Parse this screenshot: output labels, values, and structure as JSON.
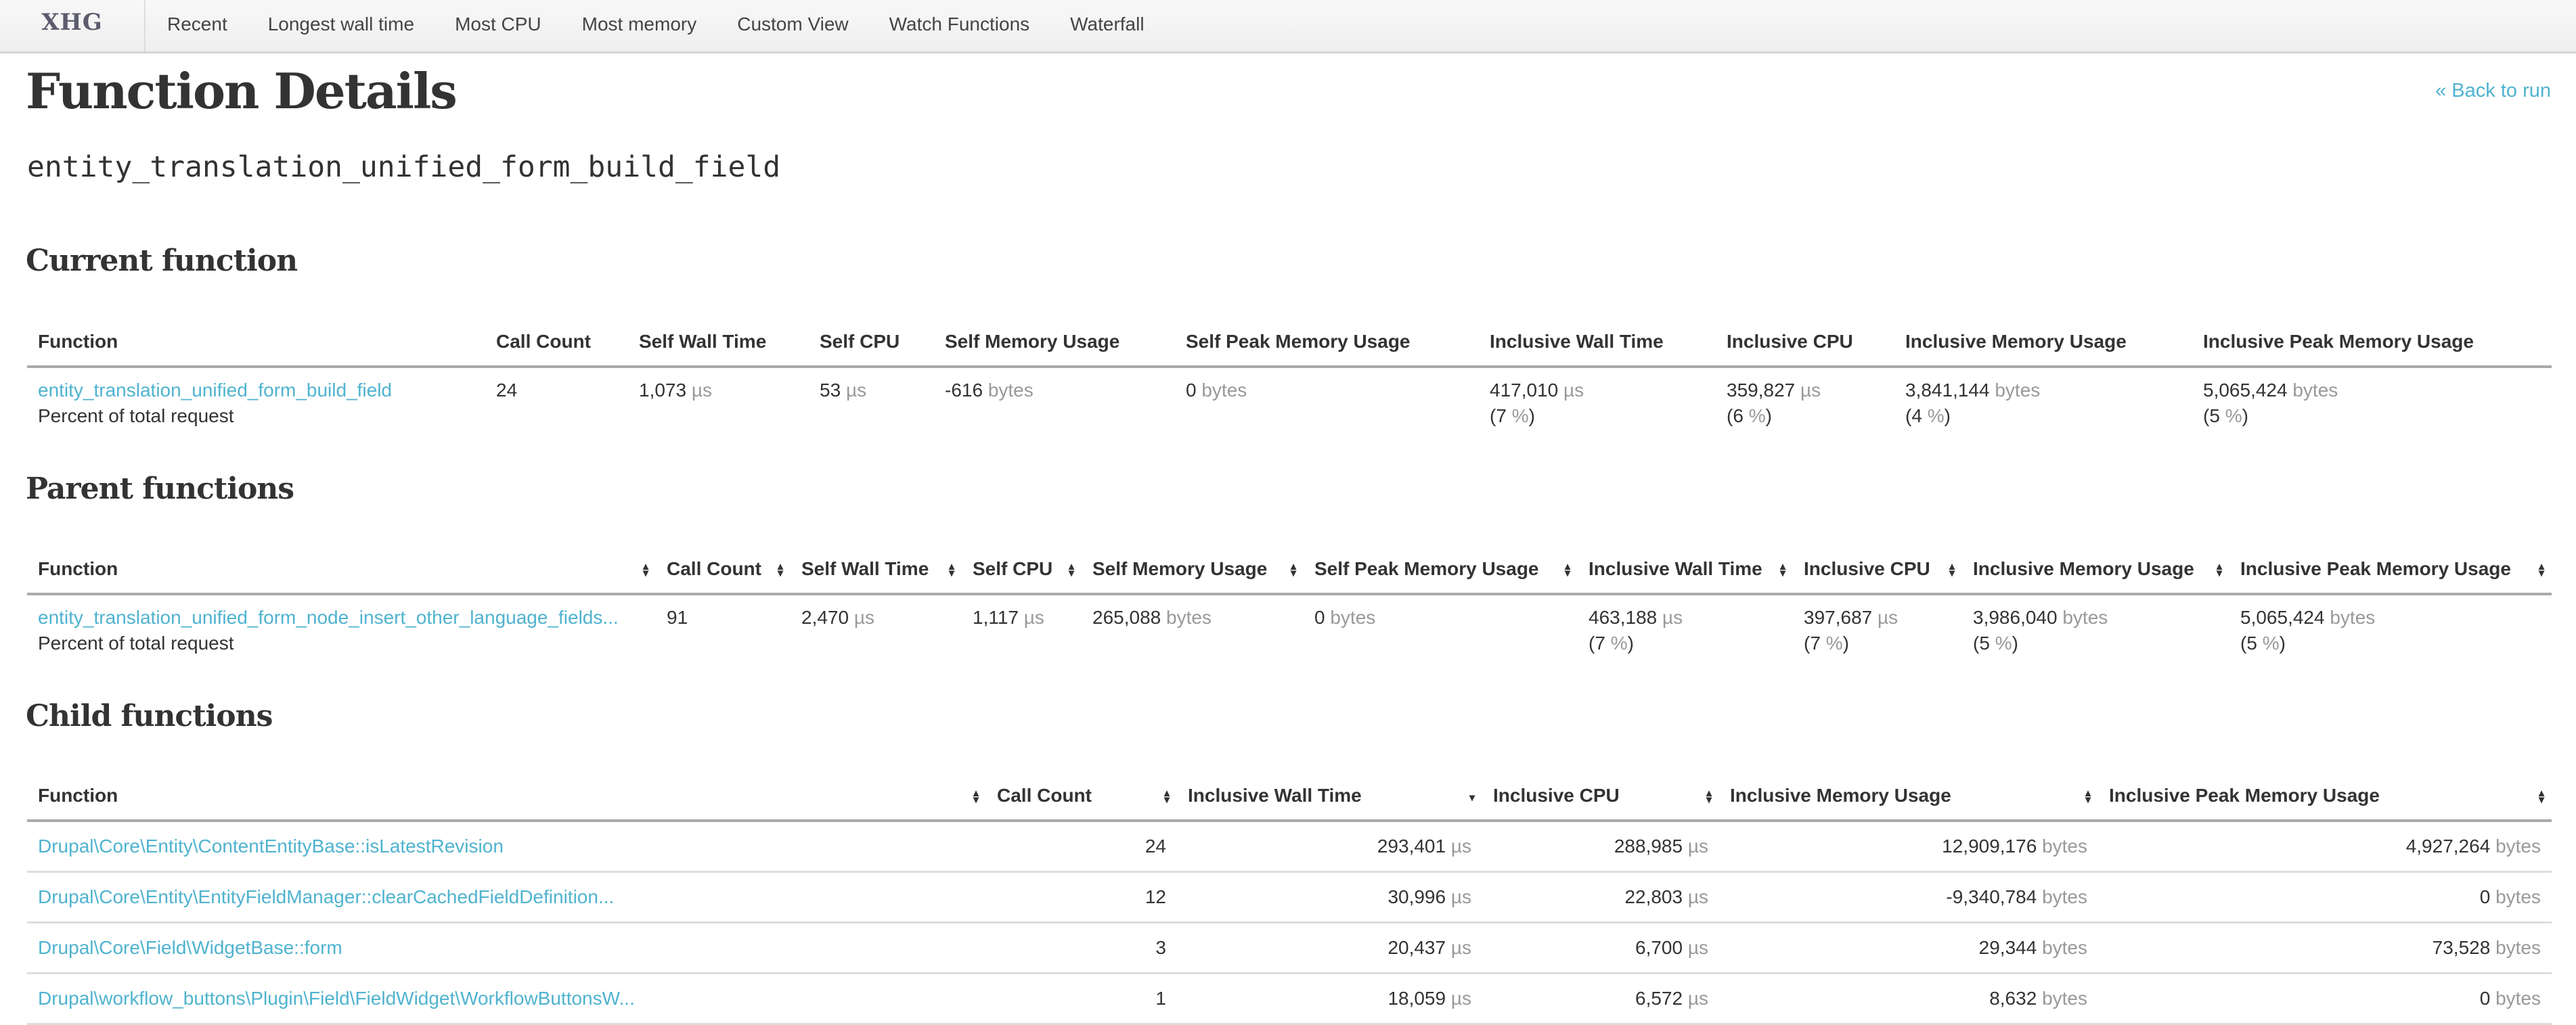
{
  "nav": {
    "brand": "XHG",
    "items": [
      "Recent",
      "Longest wall time",
      "Most CPU",
      "Most memory",
      "Custom View",
      "Watch Functions",
      "Waterfall"
    ]
  },
  "page": {
    "title": "Function Details",
    "back_link": "« Back to run",
    "function_name": "entity_translation_unified_form_build_field"
  },
  "units": {
    "time": "µs",
    "bytes": "bytes",
    "percent": "%"
  },
  "current": {
    "heading": "Current function",
    "columns": [
      "Function",
      "Call Count",
      "Self Wall Time",
      "Self CPU",
      "Self Memory Usage",
      "Self Peak Memory Usage",
      "Inclusive Wall Time",
      "Inclusive CPU",
      "Inclusive Memory Usage",
      "Inclusive Peak Memory Usage"
    ],
    "row": {
      "function": "entity_translation_unified_form_build_field",
      "percent_label": "Percent of total request",
      "call_count": "24",
      "self_wall": "1,073",
      "self_cpu": "53",
      "self_mem": "-616",
      "self_peak": "0",
      "incl_wall": "417,010",
      "incl_wall_pct": "7",
      "incl_cpu": "359,827",
      "incl_cpu_pct": "6",
      "incl_mem": "3,841,144",
      "incl_mem_pct": "4",
      "incl_peak": "5,065,424",
      "incl_peak_pct": "5"
    }
  },
  "parent": {
    "heading": "Parent functions",
    "columns": [
      "Function",
      "Call Count",
      "Self Wall Time",
      "Self CPU",
      "Self Memory Usage",
      "Self Peak Memory Usage",
      "Inclusive Wall Time",
      "Inclusive CPU",
      "Inclusive Memory Usage",
      "Inclusive Peak Memory Usage"
    ],
    "row": {
      "function": "entity_translation_unified_form_node_insert_other_language_fields...",
      "percent_label": "Percent of total request",
      "call_count": "91",
      "self_wall": "2,470",
      "self_cpu": "1,117",
      "self_mem": "265,088",
      "self_peak": "0",
      "incl_wall": "463,188",
      "incl_wall_pct": "7",
      "incl_cpu": "397,687",
      "incl_cpu_pct": "7",
      "incl_mem": "3,986,040",
      "incl_mem_pct": "5",
      "incl_peak": "5,065,424",
      "incl_peak_pct": "5"
    }
  },
  "child": {
    "heading": "Child functions",
    "columns": [
      "Function",
      "Call Count",
      "Inclusive Wall Time",
      "Inclusive CPU",
      "Inclusive Memory Usage",
      "Inclusive Peak Memory Usage"
    ],
    "sorted_column": "Inclusive Wall Time",
    "sort_direction": "descending",
    "rows": [
      {
        "function": "Drupal\\Core\\Entity\\ContentEntityBase::isLatestRevision",
        "call_count": "24",
        "incl_wall": "293,401",
        "incl_cpu": "288,985",
        "incl_mem": "12,909,176",
        "incl_peak": "4,927,264"
      },
      {
        "function": "Drupal\\Core\\Entity\\EntityFieldManager::clearCachedFieldDefinition...",
        "call_count": "12",
        "incl_wall": "30,996",
        "incl_cpu": "22,803",
        "incl_mem": "-9,340,784",
        "incl_peak": "0"
      },
      {
        "function": "Drupal\\Core\\Field\\WidgetBase::form",
        "call_count": "3",
        "incl_wall": "20,437",
        "incl_cpu": "6,700",
        "incl_mem": "29,344",
        "incl_peak": "73,528"
      },
      {
        "function": "Drupal\\workflow_buttons\\Plugin\\Field\\FieldWidget\\WorkflowButtonsW...",
        "call_count": "1",
        "incl_wall": "18,059",
        "incl_cpu": "6,572",
        "incl_mem": "8,632",
        "incl_peak": "0"
      }
    ]
  },
  "colors": {
    "link": "#4fb3cf",
    "unit": "#999999",
    "text": "#333333"
  }
}
